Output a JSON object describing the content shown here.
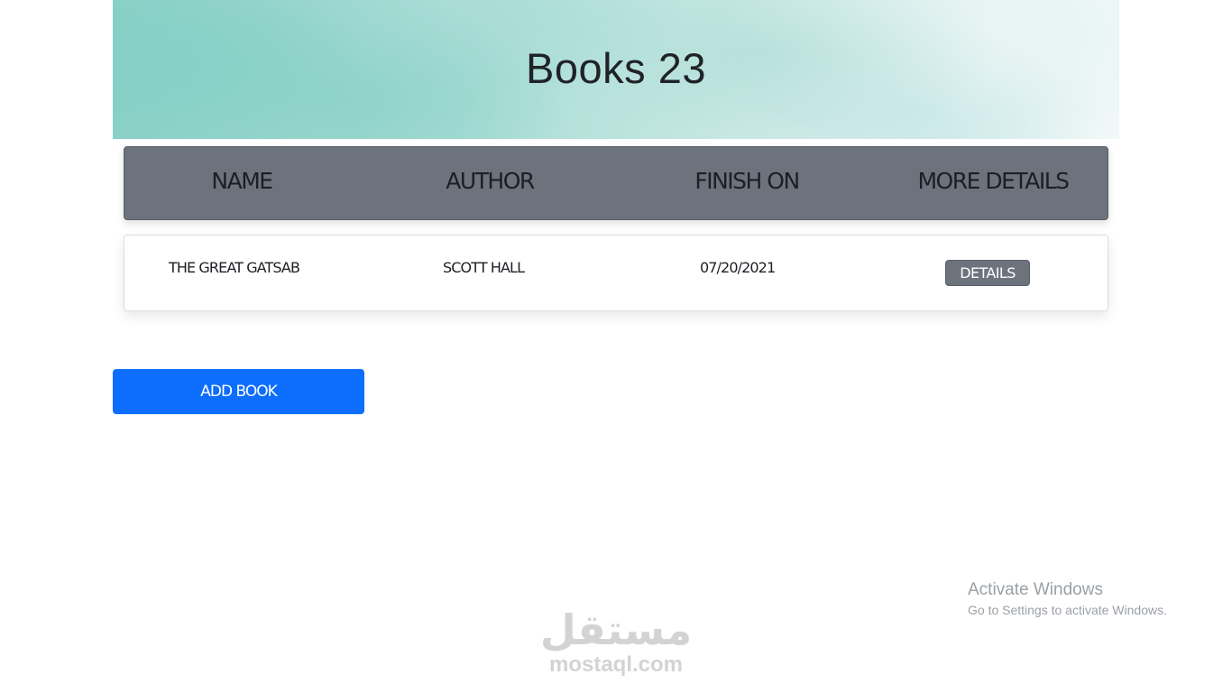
{
  "header": {
    "title": "Books 23"
  },
  "table": {
    "columns": [
      "NAME",
      "AUTHOR",
      "FINISH ON",
      "MORE DETAILS"
    ],
    "rows": [
      {
        "name": "THE GREAT GATSAB",
        "author": "SCOTT HALL",
        "finish_on": "07/20/2021",
        "details_label": "DETAILS"
      }
    ]
  },
  "actions": {
    "add_book_label": "ADD BOOK"
  },
  "os_overlay": {
    "activate_title": "Activate Windows",
    "activate_subtitle": "Go to Settings to activate Windows."
  },
  "watermark": {
    "arabic": "مستقل",
    "latin": "mostaql.com"
  },
  "colors": {
    "header_bg": "#6c737c",
    "primary": "#0d6efd",
    "hero_teal": "#86d0c7"
  }
}
